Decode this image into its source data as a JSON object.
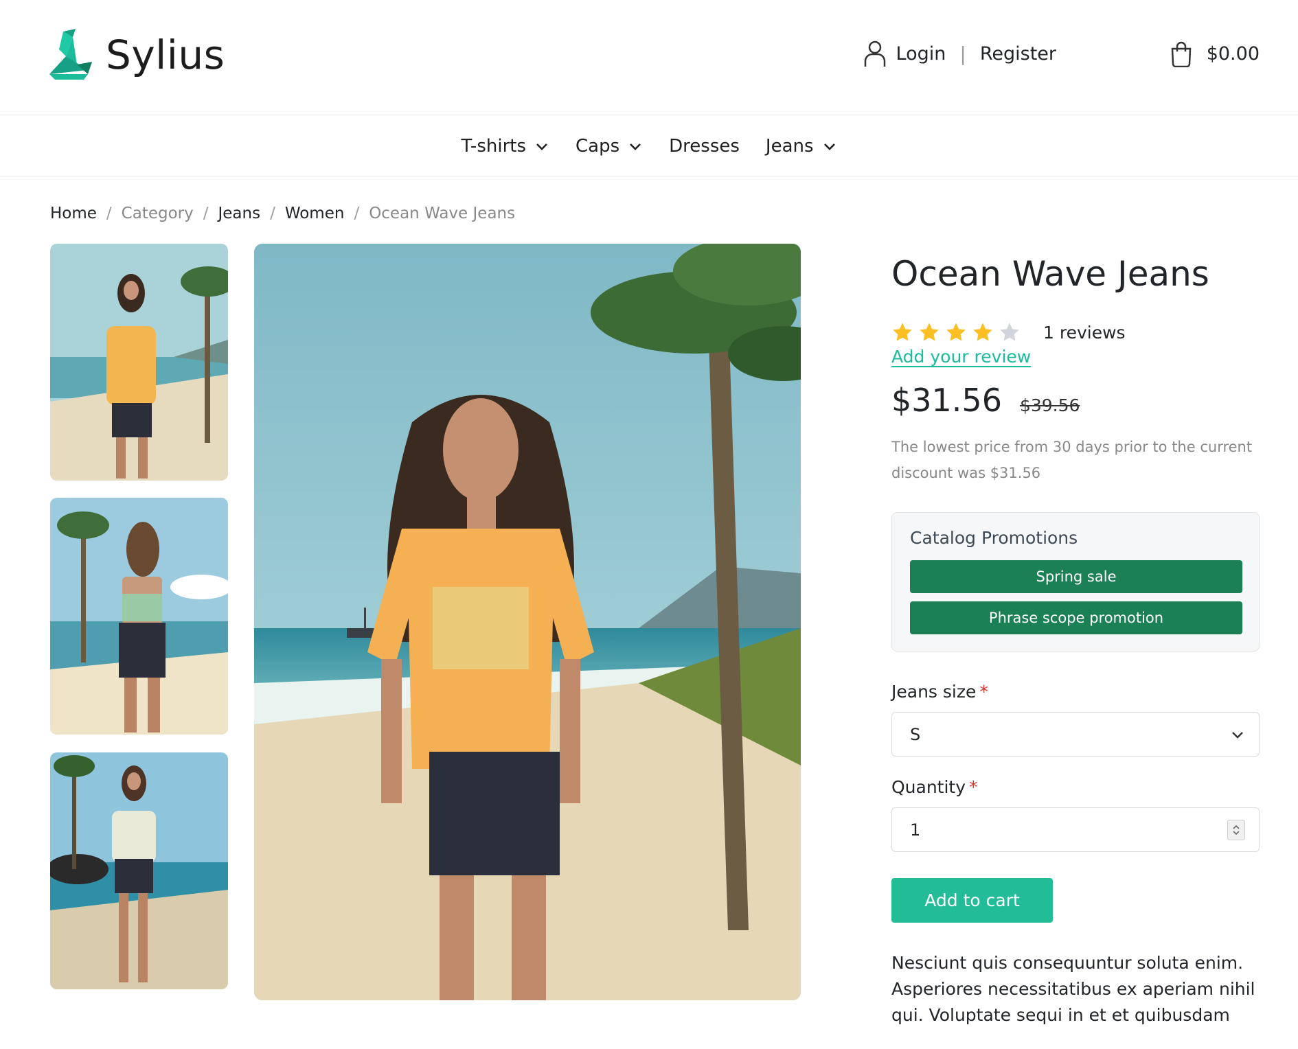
{
  "header": {
    "brand": "Sylius",
    "login_label": "Login",
    "separator": "|",
    "register_label": "Register",
    "cart_total": "$0.00",
    "icons": [
      "user-icon",
      "shopping-bag-icon"
    ],
    "brand_color": "#1abc9c"
  },
  "nav": {
    "items": [
      {
        "label": "T-shirts",
        "has_dropdown": true
      },
      {
        "label": "Caps",
        "has_dropdown": true
      },
      {
        "label": "Dresses",
        "has_dropdown": false
      },
      {
        "label": "Jeans",
        "has_dropdown": true
      }
    ]
  },
  "breadcrumb": {
    "items": [
      "Home",
      "Category",
      "Jeans",
      "Women",
      "Ocean Wave Jeans"
    ],
    "separator": "/"
  },
  "gallery": {
    "thumbnails": [
      "front-view-thumbnail",
      "back-view-thumbnail",
      "walking-view-thumbnail"
    ],
    "main_image": "woman-on-beach-in-denim-shorts"
  },
  "product": {
    "title": "Ocean Wave Jeans",
    "rating": 4,
    "rating_max": 5,
    "reviews_text": "1 reviews",
    "add_review_label": "Add your review",
    "price": "$31.56",
    "original_price": "$39.56",
    "lowest_price_note": "The lowest price from 30 days prior to the current discount was $31.56",
    "promotions": {
      "title": "Catalog Promotions",
      "items": [
        "Spring sale",
        "Phrase scope promotion"
      ],
      "badge_color": "#1b8054"
    },
    "size_field": {
      "label": "Jeans size",
      "required_mark": "*",
      "value": "S"
    },
    "quantity_field": {
      "label": "Quantity",
      "required_mark": "*",
      "value": "1"
    },
    "add_to_cart_label": "Add to cart",
    "description": "Nesciunt quis consequuntur soluta enim. Asperiores necessitatibus ex aperiam nihil qui. Voluptate sequi in et et quibusdam",
    "accent_color": "#22bc97",
    "star_color": "#fbbf24"
  }
}
